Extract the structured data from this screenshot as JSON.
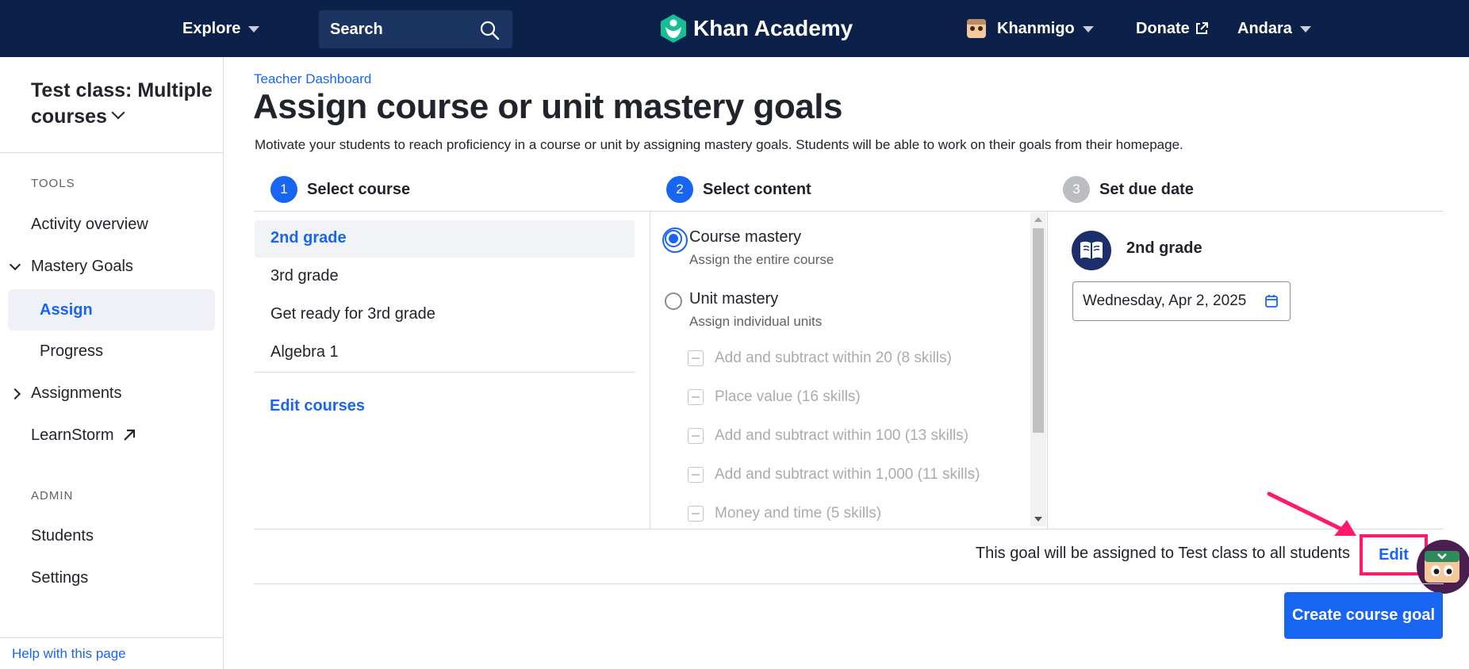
{
  "nav": {
    "explore": "Explore",
    "search_label": "Search",
    "logo_text": "Khan Academy",
    "khanmigo": "Khanmigo",
    "donate": "Donate",
    "user": "Andara",
    "bg_color": "#0b2149"
  },
  "sidebar": {
    "class_title": "Test class: Multiple courses",
    "tools_heading": "TOOLS",
    "activity_overview": "Activity overview",
    "mastery_goals": "Mastery Goals",
    "assign": "Assign",
    "progress": "Progress",
    "assignments": "Assignments",
    "learnstorm": "LearnStorm",
    "admin_heading": "ADMIN",
    "students": "Students",
    "settings": "Settings",
    "help": "Help with this page"
  },
  "main": {
    "breadcrumb": "Teacher Dashboard",
    "title": "Assign course or unit mastery goals",
    "description": "Motivate your students to reach proficiency in a course or unit by assigning mastery goals. Students will be able to work on their goals from their homepage.",
    "steps": [
      {
        "number": "1",
        "label": "Select course"
      },
      {
        "number": "2",
        "label": "Select content"
      },
      {
        "number": "3",
        "label": "Set due date"
      }
    ],
    "courses": [
      "2nd grade",
      "3rd grade",
      "Get ready for 3rd grade",
      "Algebra 1"
    ],
    "edit_courses": "Edit courses",
    "content": {
      "course_mastery": "Course mastery",
      "course_mastery_sub": "Assign the entire course",
      "unit_mastery": "Unit mastery",
      "unit_mastery_sub": "Assign individual units",
      "units": [
        "Add and subtract within 20 (8 skills)",
        "Place value (16 skills)",
        "Add and subtract within 100 (13 skills)",
        "Add and subtract within 1,000 (11 skills)",
        "Money and time (5 skills)"
      ]
    },
    "due": {
      "course_name": "2nd grade",
      "date": "Wednesday, Apr 2, 2025"
    },
    "assign_note": "This goal will be assigned to Test class to all students",
    "edit": "Edit",
    "create_button": "Create course goal"
  },
  "colors": {
    "accent": "#1865f2",
    "highlight": "#ff1a6e"
  }
}
